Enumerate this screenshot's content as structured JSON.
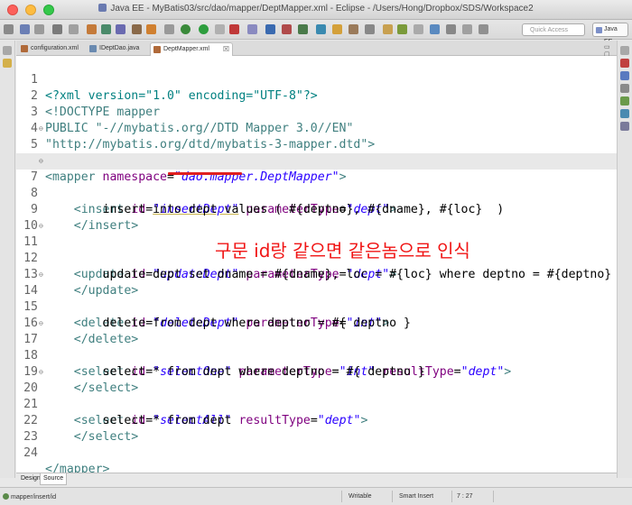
{
  "window": {
    "title": "Java EE - MyBatis03/src/dao/mapper/DeptMapper.xml - Eclipse - /Users/Hong/Dropbox/SDS/Workspace2"
  },
  "toolbar": {
    "quick_access_placeholder": "Quick Access",
    "perspective_label": "Java EE"
  },
  "tabs": [
    {
      "label": "configuration.xml",
      "active": false
    },
    {
      "label": "IDeptDao.java",
      "active": false
    },
    {
      "label": "DeptMapper.xml",
      "active": true
    }
  ],
  "editor": {
    "lines": [
      {
        "num": "1"
      },
      {
        "num": "2"
      },
      {
        "num": "3"
      },
      {
        "num": "4"
      },
      {
        "num": "5",
        "fold": "⊖"
      },
      {
        "num": "6"
      },
      {
        "num": "7",
        "fold": "⊖"
      },
      {
        "num": "8"
      },
      {
        "num": "9"
      },
      {
        "num": "10"
      },
      {
        "num": "11",
        "fold": "⊖"
      },
      {
        "num": "12"
      },
      {
        "num": "13"
      },
      {
        "num": "14",
        "fold": "⊖"
      },
      {
        "num": "15"
      },
      {
        "num": "16"
      },
      {
        "num": "17",
        "fold": "⊖"
      },
      {
        "num": "18"
      },
      {
        "num": "19"
      },
      {
        "num": "20",
        "fold": "⊖"
      },
      {
        "num": "21"
      },
      {
        "num": "22"
      },
      {
        "num": "23"
      },
      {
        "num": "24"
      }
    ],
    "code": {
      "l1_pi": "<?xml version=\"1.0\" encoding=\"UTF-8\"?>",
      "l2": "<!DOCTYPE mapper",
      "l3": "PUBLIC \"-//mybatis.org//DTD Mapper 3.0//EN\"",
      "l4": "\"http://mybatis.org/dtd/mybatis-3-mapper.dtd\">",
      "l5_tag": "<mapper",
      "l5_attr": "namespace",
      "l5_val": "\"dao.mapper.DeptMapper\"",
      "l5_end": ">",
      "l7_tag": "<insert",
      "l7_attr": "id",
      "l7_val": "\"insertDept\"",
      "l7_attr2": "parameterType",
      "l7_val2": "\"dept\"",
      "l7_end": ">",
      "l8": "insert into dept values ( #{deptno}, #{dname}, #{loc}  )",
      "l9_tag": "</insert>",
      "l11_tag": "<update",
      "l11_attr": "id",
      "l11_val": "\"updateDept\"",
      "l11_attr2": "parameterType",
      "l11_val2": "\"dept\"",
      "l11_end": ">",
      "l12": "update dept set dname = #{dname}, loc = #{loc} where deptno = #{deptno}",
      "l13_tag": "</update>",
      "l14_tag": "<delete",
      "l14_attr": "id",
      "l14_val": "\"deleteDept\"",
      "l14_attr2": "parameterType",
      "l14_val2": "\"int\"",
      "l14_end": ">",
      "l15": "delete from dept where deptno = #{ deptno }",
      "l16_tag": "</delete>",
      "l17_tag": "<select",
      "l17_attr": "id",
      "l17_val": "\"selectOne\"",
      "l17_attr2": "parameterType",
      "l17_val2": "\"int\"",
      "l17_attr3": "resultType",
      "l17_val3": "\"dept\"",
      "l17_end": ">",
      "l18": "select * from dept where deptno = #{ deptno }",
      "l19_tag": "</select>",
      "l20_tag": "<select",
      "l20_attr": "id",
      "l20_val": "\"selectAll\"",
      "l20_attr2": "resultType",
      "l20_val2": "\"dept\"",
      "l20_end": ">",
      "l21": "select * from dept",
      "l22_tag": "</select>",
      "l24_tag": "</mapper>"
    },
    "annotation": "구문 id랑 같으면 같은놈으로 인식"
  },
  "bottom_tabs": [
    {
      "label": "Design",
      "active": false
    },
    {
      "label": "Source",
      "active": true
    }
  ],
  "status": {
    "path": "mapper/insert/id",
    "writable": "Writable",
    "insert_mode": "Smart Insert",
    "position": "7 : 27"
  }
}
